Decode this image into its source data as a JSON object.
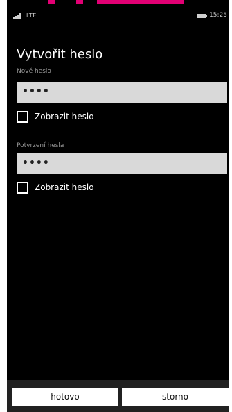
{
  "status_bar": {
    "network": "LTE",
    "time": "15:25",
    "signal_icon": "signal-strength-icon",
    "battery_icon": "battery-icon"
  },
  "brand": {
    "color": "#e20074"
  },
  "page": {
    "title": "Vytvořit heslo"
  },
  "new_password": {
    "label": "Nové heslo",
    "value": "••••",
    "show_password_label": "Zobrazit heslo",
    "show_password_checked": false
  },
  "confirm_password": {
    "label": "Potvrzení hesla",
    "value": "••••",
    "show_password_label": "Zobrazit heslo",
    "show_password_checked": false
  },
  "app_bar": {
    "done_label": "hotovo",
    "cancel_label": "storno"
  }
}
